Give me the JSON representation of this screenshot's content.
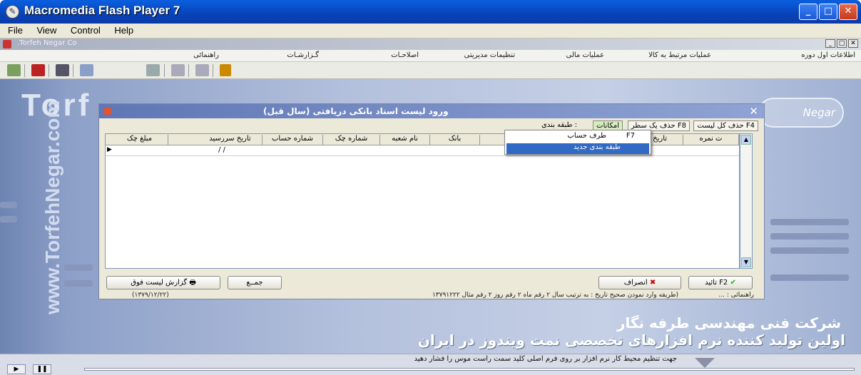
{
  "window": {
    "title": "Macromedia Flash Player 7"
  },
  "menubar": {
    "items": [
      "File",
      "View",
      "Control",
      "Help"
    ]
  },
  "inner": {
    "title": ".Torfeh Negar Co"
  },
  "appmenu": {
    "items": [
      "اطلاعات اول دوره",
      "عملیات مرتبط به کالا",
      "عملیات مالی",
      "تنظیمات مدیریتی",
      "اصلاحـات",
      "گـزارشـات",
      "راهنمائی"
    ]
  },
  "desktop": {
    "watermark": "Torf",
    "side_text": "www.TorfehNegar.com",
    "company_line1": "شرکت فنی مهندسی طرفه نگار",
    "company_line2": "اولین تولید کننده نرم افزارهای تخصصی نمت ویندوز در ایران"
  },
  "dialog": {
    "title": "ورود لیست اسناد بانکی دریافتی (سال قبل)",
    "tabs": [
      "حذف کل لیست F4",
      "حذف یک سطر F8",
      "امکانات",
      "طبقه بندی :"
    ],
    "columns": [
      "مبلغ چک",
      "تاریخ سررسید",
      "شماره حساب",
      "شماره چک",
      "نام شعبه",
      "بانک",
      "تاریخ ص",
      "ت نمره"
    ],
    "row_date": "/ /",
    "context_menu": [
      {
        "label": "طرف حساب",
        "shortcut": "F7"
      },
      {
        "label": "طبقه بندی جدید"
      }
    ],
    "buttons": {
      "confirm": "تائید F2",
      "cancel": "انصراف",
      "sum": "جمــع",
      "report": "گزارش لیست فوق"
    },
    "status_right": "... : راهنمائی",
    "status_hint": "(طریقه وارد نمودن صحیح تاریخ : به ترتیب سال ۲ رقم ماه ۲ رقم روز ۲ رقم مثال ۱۳۷۹۱۲۲۲",
    "status_left": "(۱۳۷۹/۱۲/۲۲)"
  },
  "player": {
    "hint": "جهت تنظیم محیط کار نرم افزار بر روی فرم اصلی کلید سمت راست موس را فشار دهید"
  }
}
